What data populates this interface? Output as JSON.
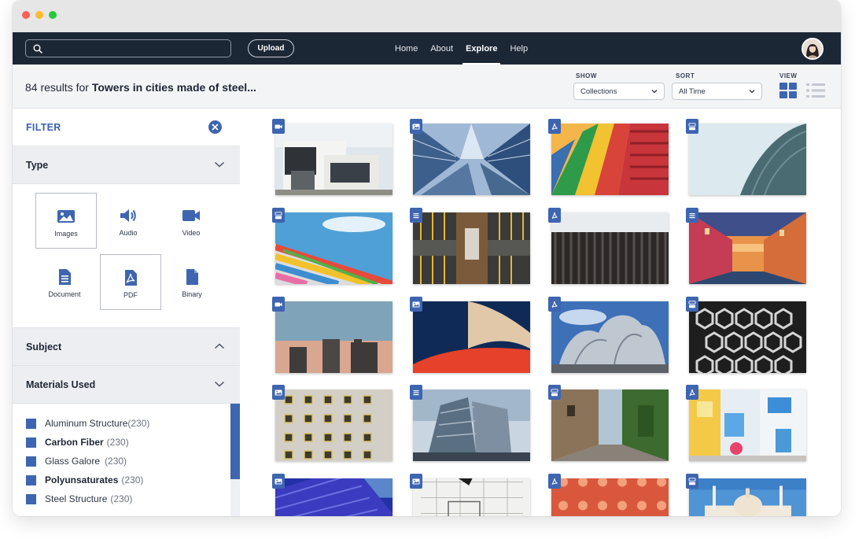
{
  "window": {
    "traffic_lights": [
      "close",
      "minimize",
      "maximize"
    ]
  },
  "topnav": {
    "search_value": "",
    "search_placeholder": "",
    "upload_label": "Upload",
    "links": [
      {
        "label": "Home",
        "active": false
      },
      {
        "label": "About",
        "active": false
      },
      {
        "label": "Explore",
        "active": true
      },
      {
        "label": "Help",
        "active": false
      }
    ]
  },
  "results": {
    "count_prefix": "84 results for ",
    "query": "Towers in cities made of steel..."
  },
  "controls": {
    "show_label": "SHOW",
    "show_value": "Collections",
    "sort_label": "SORT",
    "sort_value": "All Time",
    "view_label": "VIEW",
    "view_mode": "grid"
  },
  "filter": {
    "title": "FILTER",
    "type_section": "Type",
    "types": [
      {
        "label": "Images",
        "icon": "image-icon",
        "selected": true
      },
      {
        "label": "Audio",
        "icon": "audio-icon",
        "selected": false
      },
      {
        "label": "Video",
        "icon": "video-icon",
        "selected": false
      },
      {
        "label": "Document",
        "icon": "document-icon",
        "selected": false
      },
      {
        "label": "PDF",
        "icon": "pdf-icon",
        "selected": true
      },
      {
        "label": "Binary",
        "icon": "binary-icon",
        "selected": false
      }
    ],
    "subject_section": "Subject",
    "materials_section": "Materials Used",
    "materials": [
      {
        "name": "Aluminum Structure",
        "count": "(230)",
        "bold": false
      },
      {
        "name": "Carbon Fiber",
        "count": "(230)",
        "bold": true
      },
      {
        "name": "Glass Galore",
        "count": "(230)",
        "bold": false
      },
      {
        "name": "Polyunsaturates",
        "count": "(230)",
        "bold": true
      },
      {
        "name": "Steel Structure",
        "count": "(230)",
        "bold": false
      }
    ]
  },
  "colors": {
    "accent": "#3e65b0",
    "nav_bg": "#1c2736",
    "panel_bg": "#eceef1"
  },
  "gallery": [
    {
      "badge": "video-icon",
      "scene": "modern-house"
    },
    {
      "badge": "image-icon",
      "scene": "glass-towers-upward"
    },
    {
      "badge": "pdf-icon",
      "scene": "colorful-facade"
    },
    {
      "badge": "binary-icon",
      "scene": "curved-metal-building"
    },
    {
      "badge": "binary-icon",
      "scene": "rainbow-panels-sky"
    },
    {
      "badge": "document-icon",
      "scene": "aerial-parking"
    },
    {
      "badge": "pdf-icon",
      "scene": "dark-fins-building"
    },
    {
      "badge": "document-icon",
      "scene": "canal-sunset"
    },
    {
      "badge": "video-icon",
      "scene": "skyline-dusk"
    },
    {
      "badge": "image-icon",
      "scene": "red-curve-architecture"
    },
    {
      "badge": "pdf-icon",
      "scene": "gehry-steel"
    },
    {
      "badge": "binary-icon",
      "scene": "hexagon-facade"
    },
    {
      "badge": "image-icon",
      "scene": "window-grid-wall"
    },
    {
      "badge": "document-icon",
      "scene": "titanic-building"
    },
    {
      "badge": "binary-icon",
      "scene": "old-street"
    },
    {
      "badge": "pdf-icon",
      "scene": "colorful-balconies"
    },
    {
      "badge": "image-icon",
      "scene": "blue-tiles"
    },
    {
      "badge": "image-icon",
      "scene": "sketch-blueprint"
    },
    {
      "badge": "pdf-icon",
      "scene": "pink-palace"
    },
    {
      "badge": "binary-icon",
      "scene": "white-mosque"
    }
  ]
}
